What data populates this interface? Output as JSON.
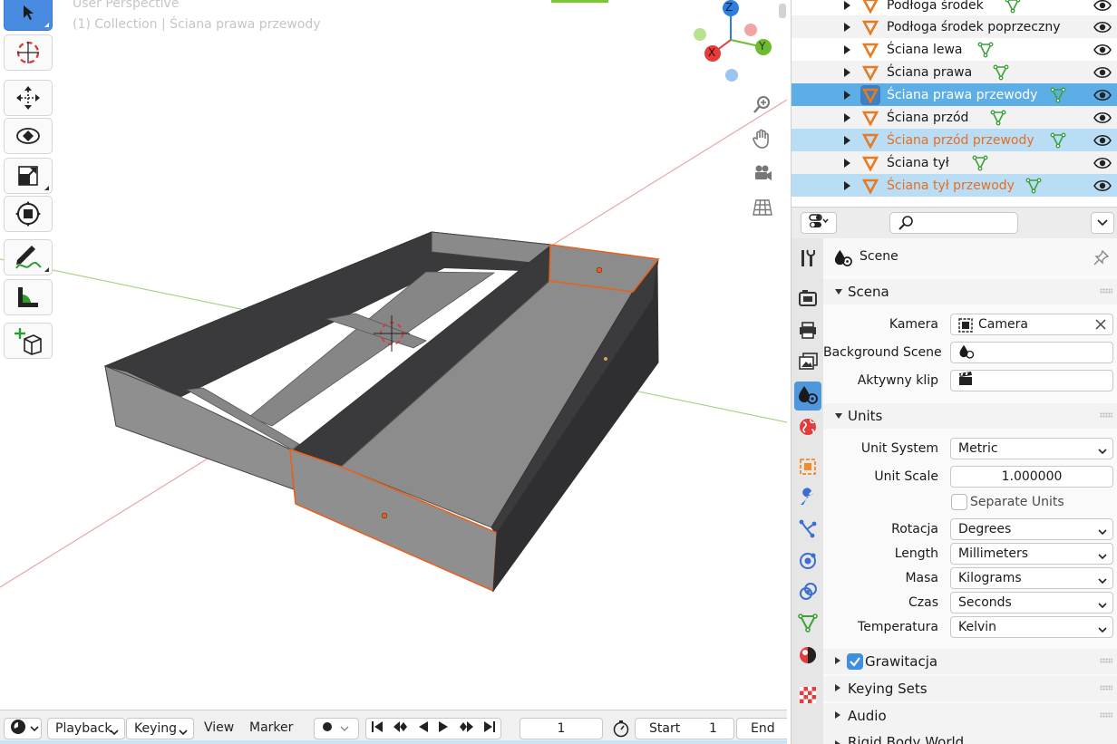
{
  "viewport": {
    "header_line1": "User Perspective",
    "header_line2": "(1) Collection | Ściana prawa przewody",
    "gizmo": {
      "x_label": "X",
      "y_label": "Y",
      "z_label": "Z"
    }
  },
  "toolbar": {
    "tools": [
      {
        "name": "select-tool",
        "icon": "cursor-arrow-icon",
        "active": true
      },
      {
        "name": "cursor-tool",
        "icon": "3d-cursor-icon"
      },
      {
        "name": "move-tool",
        "icon": "move-arrows-icon"
      },
      {
        "name": "rotate-tool",
        "icon": "rotate-icon"
      },
      {
        "name": "scale-tool",
        "icon": "scale-icon"
      },
      {
        "name": "transform-tool",
        "icon": "transform-icon"
      },
      {
        "name": "annotate-tool",
        "icon": "pencil-icon"
      },
      {
        "name": "measure-tool",
        "icon": "ruler-icon"
      },
      {
        "name": "add-cube-tool",
        "icon": "add-cube-icon"
      }
    ]
  },
  "timeline": {
    "playback_label": "Playback",
    "keying_label": "Keying",
    "view_label": "View",
    "marker_label": "Marker",
    "current_frame": "1",
    "start_label": "Start",
    "start_value": "1",
    "end_label": "End"
  },
  "outliner": {
    "rows": [
      {
        "name": "Podłoga środek",
        "state": "normal"
      },
      {
        "name": "Podłoga środek poprzeczny",
        "state": "alt"
      },
      {
        "name": "Ściana lewa",
        "state": "normal"
      },
      {
        "name": "Ściana prawa",
        "state": "alt"
      },
      {
        "name": "Ściana prawa przewody",
        "state": "selected"
      },
      {
        "name": "Ściana przód",
        "state": "alt"
      },
      {
        "name": "Ściana przód przewody",
        "state": "highlight"
      },
      {
        "name": "Ściana tył",
        "state": "alt"
      },
      {
        "name": "Ściana tył przewody",
        "state": "highlight"
      }
    ]
  },
  "properties": {
    "context_title": "Scene",
    "search_placeholder": "",
    "sections": {
      "scena": "Scena",
      "units": "Units",
      "gravity": "Grawitacja",
      "keying_sets": "Keying Sets",
      "audio": "Audio",
      "rigid_body": "Rigid Body World"
    },
    "scena": {
      "camera_label": "Kamera",
      "camera_value": "Camera",
      "background_label": "Background Scene",
      "clip_label": "Aktywny klip"
    },
    "units": {
      "unit_system_label": "Unit System",
      "unit_system_value": "Metric",
      "unit_scale_label": "Unit Scale",
      "unit_scale_value": "1.000000",
      "separate_units_label": "Separate Units",
      "rotation_label": "Rotacja",
      "rotation_value": "Degrees",
      "length_label": "Length",
      "length_value": "Millimeters",
      "mass_label": "Masa",
      "mass_value": "Kilograms",
      "time_label": "Czas",
      "time_value": "Seconds",
      "temperature_label": "Temperatura",
      "temperature_value": "Kelvin"
    },
    "gravity_checked": true,
    "separate_units_checked": false,
    "colors": {
      "accent": "#4f97dd",
      "selected_row": "#5daee6",
      "highlight_row": "#b9ddf4",
      "object_orange": "#e86d20",
      "mesh_green": "#3aa23a"
    }
  }
}
